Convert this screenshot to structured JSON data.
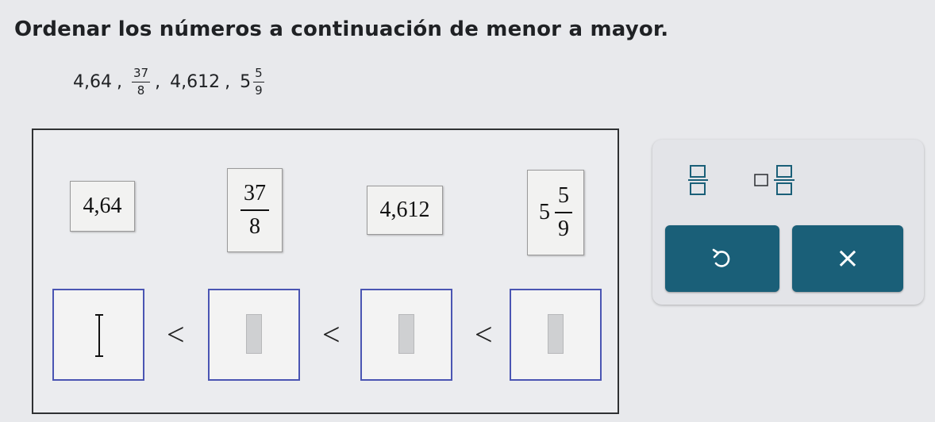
{
  "instruction": "Ordenar los números a continuación de menor a mayor.",
  "question": {
    "items": [
      {
        "type": "decimal",
        "text": "4,64"
      },
      {
        "type": "fraction",
        "numerator": "37",
        "denominator": "8"
      },
      {
        "type": "decimal",
        "text": "4,612"
      },
      {
        "type": "mixed",
        "whole": "5",
        "numerator": "5",
        "denominator": "9"
      }
    ],
    "separator": ","
  },
  "tiles": [
    {
      "type": "decimal",
      "text": "4,64"
    },
    {
      "type": "fraction",
      "numerator": "37",
      "denominator": "8"
    },
    {
      "type": "decimal",
      "text": "4,612"
    },
    {
      "type": "mixed",
      "whole": "5",
      "numerator": "5",
      "denominator": "9"
    }
  ],
  "answer": {
    "slots": [
      "",
      "",
      "",
      ""
    ],
    "comparator": "<"
  },
  "toolbox": {
    "tools": [
      {
        "icon": "fraction-template-icon"
      },
      {
        "icon": "mixed-number-template-icon"
      }
    ],
    "undo_icon": "undo-icon",
    "clear_icon": "clear-x-icon",
    "clear_symbol": "×",
    "accent_color": "#1a5f78"
  }
}
